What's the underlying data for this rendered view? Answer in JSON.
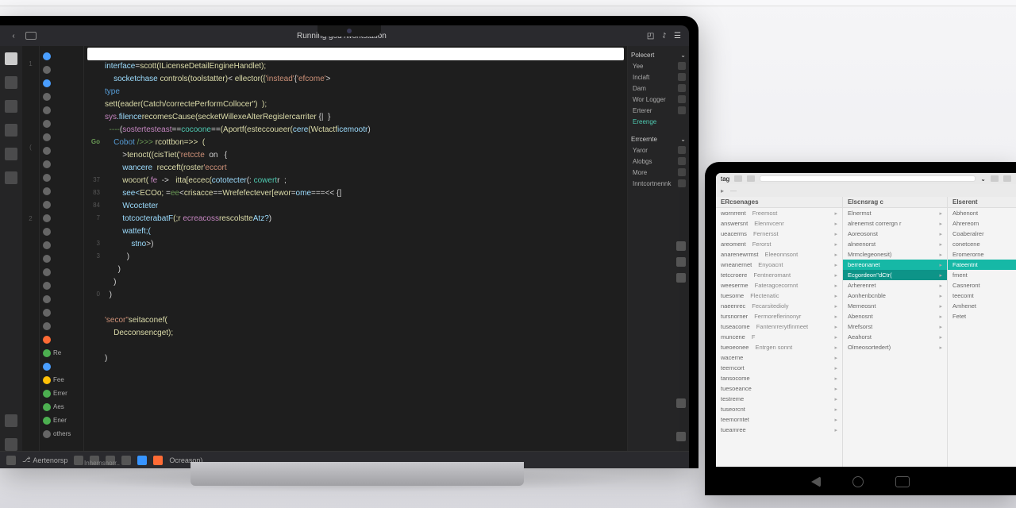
{
  "ide": {
    "title": "Running god /workstation",
    "search_placeholder": "",
    "activity_icons": [
      "explorer",
      "search",
      "scm",
      "debug",
      "extensions",
      "test",
      "remote",
      "account"
    ],
    "gutter_marks": [
      "1",
      "",
      "",
      "",
      "",
      "",
      "",
      "(",
      "",
      "",
      "",
      "",
      "",
      "2",
      "",
      "",
      "",
      "",
      "",
      ""
    ],
    "file_items": [
      {
        "color": "blue",
        "label": ""
      },
      {
        "color": "gray",
        "label": ""
      },
      {
        "color": "blue",
        "label": ""
      },
      {
        "color": "gray",
        "label": ""
      },
      {
        "color": "gray",
        "label": ""
      },
      {
        "color": "gray",
        "label": ""
      },
      {
        "color": "gray",
        "label": ""
      },
      {
        "color": "gray",
        "label": ""
      },
      {
        "color": "gray",
        "label": ""
      },
      {
        "color": "gray",
        "label": ""
      },
      {
        "color": "gray",
        "label": ""
      },
      {
        "color": "gray",
        "label": ""
      },
      {
        "color": "gray",
        "label": ""
      },
      {
        "color": "gray",
        "label": ""
      },
      {
        "color": "gray",
        "label": ""
      },
      {
        "color": "gray",
        "label": ""
      },
      {
        "color": "gray",
        "label": ""
      },
      {
        "color": "gray",
        "label": ""
      },
      {
        "color": "gray",
        "label": ""
      },
      {
        "color": "gray",
        "label": ""
      },
      {
        "color": "gray",
        "label": ""
      },
      {
        "color": "orange",
        "label": ""
      },
      {
        "color": "green",
        "label": "Re"
      },
      {
        "color": "blue",
        "label": ""
      },
      {
        "color": "yellow",
        "label": "Fee"
      },
      {
        "color": "green",
        "label": "Errer"
      },
      {
        "color": "green",
        "label": "Aes"
      },
      {
        "color": "green",
        "label": "Ener"
      },
      {
        "color": "gray",
        "label": "others"
      }
    ],
    "line_numbers": [
      "",
      "",
      "",
      "",
      "",
      "",
      "Go",
      "",
      "",
      "37",
      "83",
      "84",
      "7",
      "",
      "3",
      "3",
      "",
      "",
      "0",
      "",
      "",
      "",
      "",
      "",
      "",
      "",
      ""
    ],
    "code_lines": [
      {
        "indent": 0,
        "tokens": [
          [
            "prop",
            "interface"
          ],
          [
            "op",
            "="
          ],
          [
            "fn",
            "scott(ILicenseDetailEngineHandlet);"
          ]
        ]
      },
      {
        "indent": 2,
        "tokens": [
          [
            "prop",
            "socketchase"
          ],
          [
            "op",
            " "
          ],
          [
            "fn",
            "controls(toolstatter)"
          ],
          [
            "op",
            "< "
          ],
          [
            "fn",
            "ellector({"
          ],
          [
            "str",
            "'instead'"
          ],
          [
            "op",
            "{"
          ],
          [
            "str",
            "'efcome'"
          ],
          [
            "op",
            ">"
          ]
        ]
      },
      {
        "indent": 0,
        "tokens": [
          [
            "kw",
            "type"
          ]
        ]
      },
      {
        "indent": 0,
        "tokens": [
          [
            "fn",
            "sett(eader(Catch/correctePerformCollocer\")  );"
          ]
        ]
      },
      {
        "indent": 0,
        "tokens": [
          [
            "pink",
            "sys"
          ],
          [
            "prop",
            ".filence"
          ],
          [
            "fn",
            "recomesCause(secketWillexeAlterRegislercarriter "
          ],
          [
            "op",
            "{|  }"
          ]
        ]
      },
      {
        "indent": 0,
        "tokens": [
          [
            "cm",
            "  ----"
          ],
          [
            "op",
            "("
          ],
          [
            "pink",
            "sostertesteast"
          ],
          [
            "op",
            "=="
          ],
          [
            "ty",
            "cocoone"
          ],
          [
            "op",
            "=="
          ],
          [
            "fn",
            "(Aportf(esteccoueer("
          ],
          [
            "prop",
            "cere"
          ],
          [
            "fn",
            "(Wctactf"
          ],
          [
            "prop",
            "icemootr"
          ],
          [
            "op",
            ")"
          ]
        ]
      },
      {
        "indent": 2,
        "tokens": [
          [
            "kw",
            "Cobot"
          ],
          [
            "cm",
            " />>> "
          ],
          [
            "fn",
            "rcottbon=>>  ("
          ]
        ]
      },
      {
        "indent": 4,
        "tokens": [
          [
            "op",
            ">"
          ],
          [
            "fn",
            "tenoct((cisTiet("
          ],
          [
            "str",
            "'retccte"
          ],
          [
            "op",
            "  on   {"
          ]
        ]
      },
      {
        "indent": 4,
        "tokens": [
          [
            "prop",
            "wancere"
          ],
          [
            "op",
            "  "
          ],
          [
            "fn",
            "recceft(roster"
          ],
          [
            "str",
            "'eccort"
          ]
        ]
      },
      {
        "indent": 4,
        "tokens": [
          [
            "fn",
            "wocort("
          ],
          [
            "op",
            " "
          ],
          [
            "pink",
            "fe"
          ],
          [
            "op",
            "  ->   "
          ],
          [
            "fn",
            "itta[eccec("
          ],
          [
            "prop",
            "cototecter"
          ],
          [
            "op",
            "(: "
          ],
          [
            "ty",
            "cowert"
          ],
          [
            "op",
            "r  ;"
          ]
        ]
      },
      {
        "indent": 4,
        "tokens": [
          [
            "prop",
            "see<"
          ],
          [
            "fn",
            "ECOo;"
          ],
          [
            "op",
            " ="
          ],
          [
            "cm",
            "ee"
          ],
          [
            "op",
            "<"
          ],
          [
            "fn",
            "crisacce"
          ],
          [
            "op",
            "=="
          ],
          [
            "fn",
            "Wrefefectever[ewor"
          ],
          [
            "op",
            "="
          ],
          [
            "prop",
            "ome"
          ],
          [
            "op",
            "===<< {]"
          ]
        ]
      },
      {
        "indent": 4,
        "tokens": [
          [
            "prop",
            "Wcocteter"
          ]
        ]
      },
      {
        "indent": 4,
        "tokens": [
          [
            "prop",
            "totcocterabatF"
          ],
          [
            "fn",
            "(;r "
          ],
          [
            "pink",
            "ecreacoss"
          ],
          [
            "fn",
            "rescolstte"
          ],
          [
            "prop",
            "Atz?"
          ],
          [
            "op",
            ")"
          ]
        ]
      },
      {
        "indent": 4,
        "tokens": [
          [
            "prop",
            "watteft;("
          ]
        ]
      },
      {
        "indent": 6,
        "tokens": [
          [
            "prop",
            "stno"
          ],
          [
            "op",
            ">)"
          ]
        ]
      },
      {
        "indent": 5,
        "tokens": [
          [
            "op",
            ")"
          ]
        ]
      },
      {
        "indent": 3,
        "tokens": [
          [
            "op",
            ")"
          ]
        ]
      },
      {
        "indent": 2,
        "tokens": [
          [
            "op",
            ")"
          ]
        ]
      },
      {
        "indent": 1,
        "tokens": [
          [
            "op",
            ")"
          ]
        ]
      },
      {
        "indent": 0,
        "tokens": [
          [
            "op",
            ""
          ]
        ]
      },
      {
        "indent": 0,
        "tokens": [
          [
            "str",
            "'secor\""
          ],
          [
            "fn",
            "seitaconef("
          ]
        ]
      },
      {
        "indent": 2,
        "tokens": [
          [
            "fn",
            "Decconsencget);"
          ]
        ]
      },
      {
        "indent": 0,
        "tokens": [
          [
            "op",
            ""
          ]
        ]
      },
      {
        "indent": 0,
        "tokens": [
          [
            "op",
            ")"
          ]
        ]
      }
    ],
    "right_panel": {
      "sec1_head": "Polecert",
      "sec1_items": [
        {
          "l": "Yee",
          "ic": true
        },
        {
          "l": "Inclaft",
          "ic": true
        },
        {
          "l": "Dam",
          "ic": true
        },
        {
          "l": "Wor Logger",
          "ic": true
        },
        {
          "l": "Erterer",
          "ic": true
        },
        {
          "l": "Ereenge",
          "ic": false,
          "green": true
        }
      ],
      "sec2_head": "Errcernte",
      "sec2_items": [
        {
          "l": "Yaror"
        },
        {
          "l": "Alobgs"
        },
        {
          "l": "More"
        },
        {
          "l": "Inntcortnennk"
        }
      ]
    },
    "statusbar": {
      "branch": "Aertenorsp",
      "items": [
        "",
        "",
        "",
        "",
        "",
        "",
        ""
      ],
      "right": "Ocreason)"
    },
    "sidebar_label": "Inhernsnorr.."
  },
  "tablet": {
    "nav_label": "tag",
    "columns": [
      {
        "head": "ERcsenages",
        "rows": [
          "wornrrent",
          "answersnt",
          "ueacerms",
          "areoment",
          "anarenewrmst",
          "wneanernet",
          "tetccroere",
          "weeserme",
          "tuesorne",
          "naeenrec",
          "tursnorner",
          "tuseacome",
          "muncene",
          "tueoeonee",
          "wacerne",
          "teerncort",
          "tansocome",
          "tuesoeance",
          "testreme",
          "tuseorcnt",
          "teemorntet",
          "tueamree"
        ],
        "extras": [
          "Freemost",
          "Elennvcenr",
          "Fernersst",
          "Ferorst",
          "Eleeonnsont",
          "Enyoacnt",
          "Fentneromant",
          "Fateragcecornnt",
          "Flectenatic",
          "Fecarsitedioly",
          "Fermoreflerinonyr",
          "Fantenrrerytfinmeet",
          "F",
          "Entrgen sonnt"
        ]
      },
      {
        "head": "Elscnsrag c",
        "rows": [
          "Elnermst",
          "alrenemst corrergn r",
          "Aoreosonst",
          "alneenorst",
          "Mrmclegeonesit)",
          "berreonanet",
          "Ecgordeon\"dCtr(",
          "Arherenret",
          "Aonhenbcnble",
          "Merneosnt",
          "Abenosnt",
          "Mrefsorst",
          "Aeahorst",
          "Olmeosortedert)"
        ],
        "sel": 5,
        "sel2": 6
      },
      {
        "head": "Elserent",
        "rows": [
          "Abhenont",
          "Ahrereorn",
          "Coaberalrer",
          "conetcene",
          "Eromerorne",
          "Fateentnt",
          "fment",
          "Casneront",
          "teecomt",
          "Amhenet",
          "Fetet"
        ],
        "sel": 5
      }
    ]
  }
}
